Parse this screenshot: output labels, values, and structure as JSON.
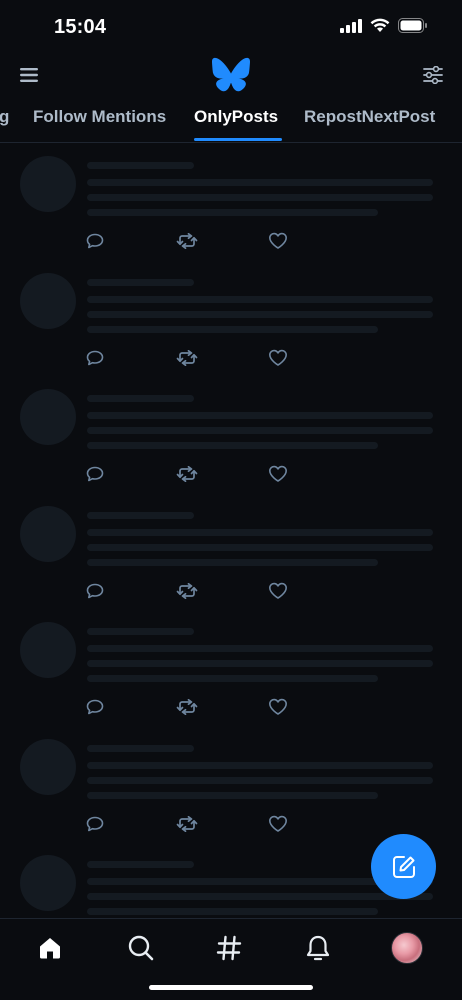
{
  "status_bar": {
    "time": "15:04",
    "icons": [
      "cellular-signal-icon",
      "wifi-icon",
      "battery-icon"
    ]
  },
  "top_bar": {
    "left_icon": "hamburger-menu-icon",
    "logo_icon": "bluesky-butterfly-icon",
    "right_icon": "feed-settings-sliders-icon"
  },
  "tabs": {
    "items": [
      {
        "label": "g"
      },
      {
        "label": "Follow Mentions"
      },
      {
        "label": "OnlyPosts"
      },
      {
        "label": "RepostNextPost"
      }
    ],
    "active_index": 2
  },
  "feed": {
    "state": "loading-skeleton",
    "post_actions": [
      "reply-icon",
      "repost-icon",
      "like-icon"
    ]
  },
  "fab": {
    "icon": "compose-post-icon"
  },
  "bottom_nav": {
    "items": [
      "home-icon",
      "search-icon",
      "feeds-hashtag-icon",
      "notifications-bell-icon",
      "profile-avatar"
    ]
  },
  "colors": {
    "background": "#0a0c10",
    "accent": "#208bfe",
    "skeleton": "#141a21",
    "inactive_text": "#aebbc9",
    "action_icon": "#6f869f"
  }
}
